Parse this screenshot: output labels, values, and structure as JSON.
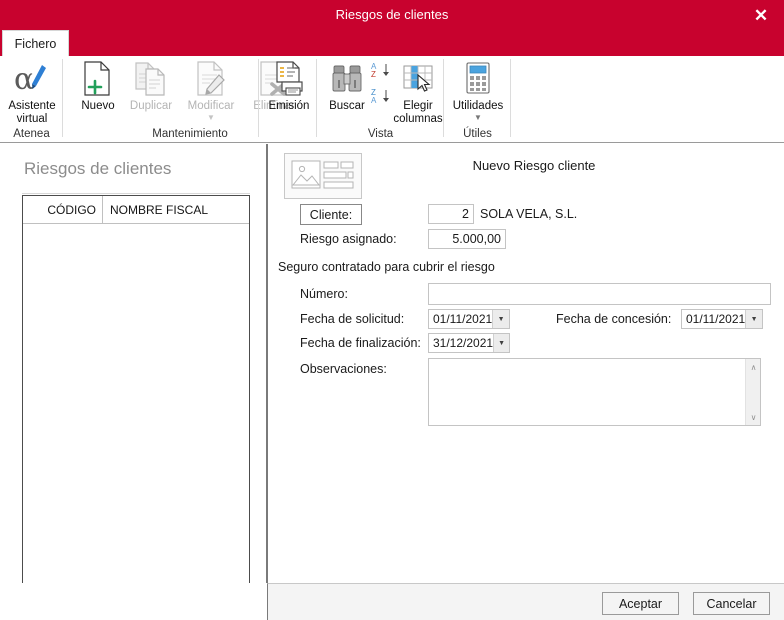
{
  "window": {
    "title": "Riesgos de clientes",
    "close_label": "✕"
  },
  "tabs": [
    {
      "label": "Fichero",
      "active": true
    }
  ],
  "ribbon": {
    "groups": [
      {
        "title": "Atenea",
        "items": [
          {
            "label": "Asistente\nvirtual",
            "icon": "alpha-pen-icon",
            "disabled": false,
            "caret": false
          }
        ]
      },
      {
        "title": "Mantenimiento",
        "items": [
          {
            "label": "Nuevo",
            "icon": "new-document-icon",
            "disabled": false,
            "caret": false
          },
          {
            "label": "Duplicar",
            "icon": "duplicate-document-icon",
            "disabled": true,
            "caret": false
          },
          {
            "label": "Modificar",
            "icon": "edit-document-icon",
            "disabled": true,
            "caret": true
          },
          {
            "label": "Eliminar",
            "icon": "delete-document-icon",
            "disabled": true,
            "caret": false
          },
          {
            "label": "Emisión",
            "icon": "print-report-icon",
            "disabled": false,
            "caret": false
          }
        ]
      },
      {
        "title": "Vista",
        "items": [
          {
            "label": "Buscar",
            "icon": "binoculars-icon",
            "disabled": false,
            "caret": false
          },
          {
            "label": "sort-az",
            "icon": "sort-ascending-icon",
            "disabled": false,
            "caret": false
          },
          {
            "label": "sort-za",
            "icon": "sort-descending-icon",
            "disabled": false,
            "caret": false
          },
          {
            "label": "Elegir\ncolumnas",
            "icon": "choose-columns-icon",
            "disabled": false,
            "caret": false
          }
        ]
      },
      {
        "title": "Útiles",
        "items": [
          {
            "label": "Utilidades",
            "icon": "calculator-icon",
            "disabled": false,
            "caret": true
          }
        ]
      }
    ],
    "group_titles": {
      "atenea": "Atenea",
      "mantenimiento": "Mantenimiento",
      "vista": "Vista",
      "utiles": "Útiles"
    },
    "labels": {
      "asistente_l1": "Asistente",
      "asistente_l2": "virtual",
      "nuevo": "Nuevo",
      "duplicar": "Duplicar",
      "modificar": "Modificar",
      "eliminar": "Eliminar",
      "emision": "Emisión",
      "buscar": "Buscar",
      "elegir_l1": "Elegir",
      "elegir_l2": "columnas",
      "utilidades": "Utilidades"
    }
  },
  "left_panel": {
    "title": "Riesgos de clientes",
    "grid": {
      "columns": [
        "CÓDIGO",
        "NOMBRE FISCAL"
      ],
      "rows": []
    }
  },
  "splitter": {
    "arrow": "❯"
  },
  "detail": {
    "heading": "Nuevo Riesgo cliente",
    "thumbnail_icon": "image-record-icon",
    "cliente": {
      "button_label": "Cliente:",
      "code_value": "2",
      "name_value": "SOLA VELA, S.L."
    },
    "riesgo_asignado": {
      "label": "Riesgo asignado:",
      "value": "5.000,00"
    },
    "section_title": "Seguro contratado para cubrir el riesgo",
    "numero": {
      "label": "Número:",
      "value": "",
      "placeholder": ""
    },
    "fecha_solicitud": {
      "label": "Fecha de solicitud:",
      "value": "01/11/2021"
    },
    "fecha_concesion": {
      "label": "Fecha de concesión:",
      "value": "01/11/2021"
    },
    "fecha_finalizacion": {
      "label": "Fecha de finalización:",
      "value": "31/12/2021"
    },
    "observaciones": {
      "label": "Observaciones:",
      "value": "",
      "scroll_up": "∧",
      "scroll_down": "∨"
    }
  },
  "footer": {
    "accept_label": "Aceptar",
    "cancel_label": "Cancelar"
  },
  "colors": {
    "brand_red": "#c8022e",
    "title_text": "#ffffff",
    "panel_bg": "#ffffff",
    "footer_bg": "#f4f4f4",
    "border_gray": "#7a7a7a"
  }
}
